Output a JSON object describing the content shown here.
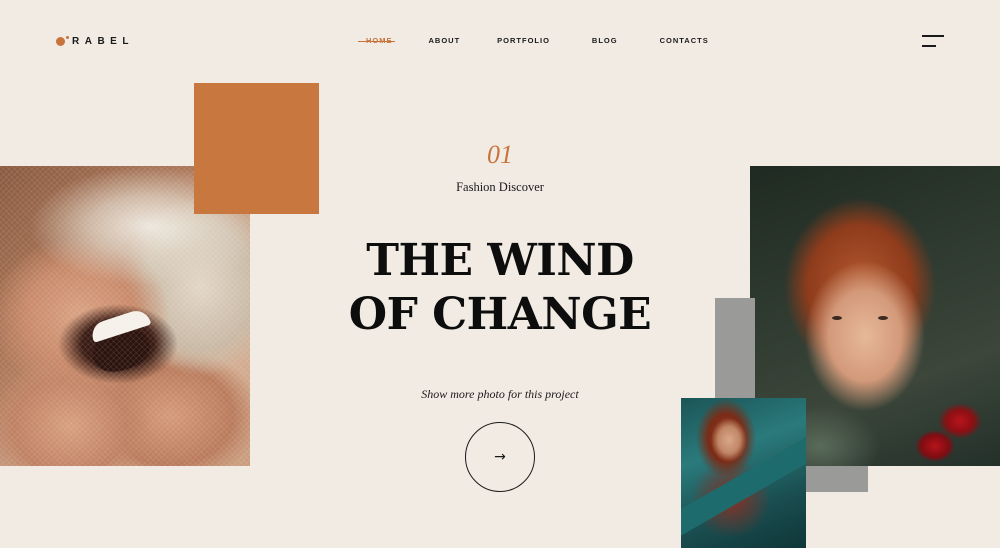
{
  "brand": {
    "logo_text": "RABEL",
    "accent": "#c8733b"
  },
  "nav": {
    "items": [
      "HOME",
      "ABOUT",
      "PORTFOLIO",
      "BLOG",
      "CONTACTS"
    ],
    "active": "HOME"
  },
  "hero": {
    "slide_number": "01",
    "subtitle": "Fashion Discover",
    "headline_line1": "THE WIND",
    "headline_line2": "OF CHANGE",
    "cta_text": "Show more photo for this project"
  },
  "icons": {
    "menu": "hamburger-icon",
    "next": "arrow-right-icon"
  },
  "colors": {
    "background": "#f2ebe4",
    "orange_block": "#c8773f",
    "gray_block": "#9a9a98"
  }
}
